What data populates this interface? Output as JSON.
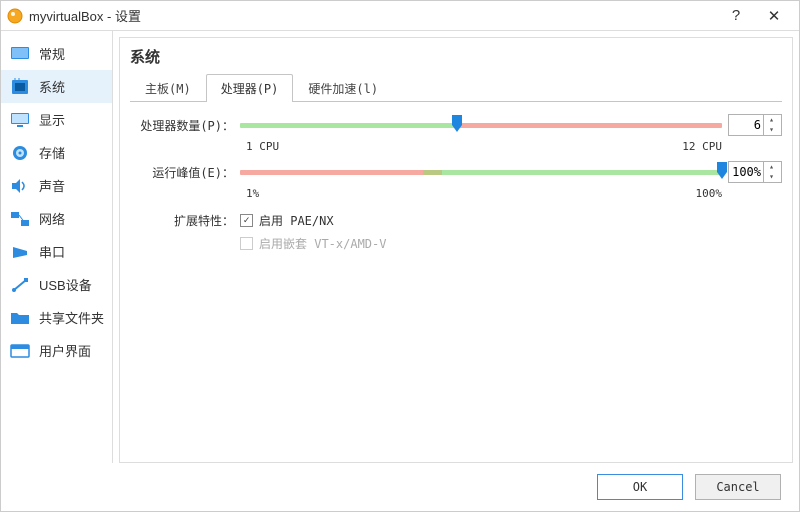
{
  "window": {
    "title": "myvirtualBox - 设置"
  },
  "sidebar": {
    "items": [
      {
        "label": "常规"
      },
      {
        "label": "系统"
      },
      {
        "label": "显示"
      },
      {
        "label": "存储"
      },
      {
        "label": "声音"
      },
      {
        "label": "网络"
      },
      {
        "label": "串口"
      },
      {
        "label": "USB设备"
      },
      {
        "label": "共享文件夹"
      },
      {
        "label": "用户界面"
      }
    ],
    "active_index": 1
  },
  "page": {
    "title": "系统"
  },
  "tabs": {
    "items": [
      {
        "label": "主板(M)"
      },
      {
        "label": "处理器(P)"
      },
      {
        "label": "硬件加速(l)"
      }
    ],
    "active_index": 1
  },
  "processor": {
    "cpu_count": {
      "label": "处理器数量(P)：",
      "value": "6",
      "min_label": "1 CPU",
      "max_label": "12 CPU",
      "min": 1,
      "max": 12
    },
    "exec_cap": {
      "label": "运行峰值(E)：",
      "value": "100%",
      "min_label": "1%",
      "max_label": "100%",
      "min": 1,
      "max": 100
    },
    "ext_label": "扩展特性：",
    "ext": [
      {
        "label": "启用 PAE/NX",
        "checked": true,
        "disabled": false
      },
      {
        "label": "启用嵌套 VT-x/AMD-V",
        "checked": false,
        "disabled": true
      }
    ]
  },
  "buttons": {
    "ok": "OK",
    "cancel": "Cancel"
  }
}
